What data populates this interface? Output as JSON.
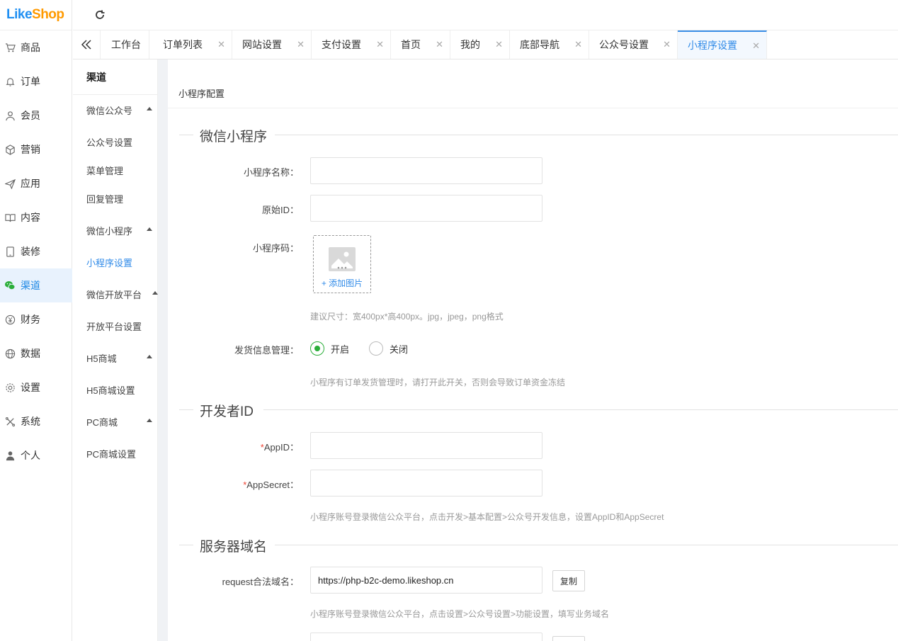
{
  "logo": {
    "part1": "Like",
    "part2": "Shop"
  },
  "sidebar": {
    "items": [
      {
        "label": "商品",
        "icon": "cart-icon"
      },
      {
        "label": "订单",
        "icon": "bell-icon"
      },
      {
        "label": "会员",
        "icon": "user-icon"
      },
      {
        "label": "营销",
        "icon": "cube-icon"
      },
      {
        "label": "应用",
        "icon": "send-icon"
      },
      {
        "label": "内容",
        "icon": "book-icon"
      },
      {
        "label": "装修",
        "icon": "tablet-icon"
      },
      {
        "label": "渠道",
        "icon": "wechat-icon"
      },
      {
        "label": "财务",
        "icon": "yen-icon"
      },
      {
        "label": "数据",
        "icon": "globe-icon"
      },
      {
        "label": "设置",
        "icon": "gear-icon"
      },
      {
        "label": "系统",
        "icon": "tools-icon"
      },
      {
        "label": "个人",
        "icon": "person-icon"
      }
    ],
    "active": "渠道"
  },
  "tabs": [
    {
      "label": "工作台",
      "closable": false
    },
    {
      "label": "订单列表",
      "closable": true
    },
    {
      "label": "网站设置",
      "closable": true
    },
    {
      "label": "支付设置",
      "closable": true
    },
    {
      "label": "首页",
      "closable": true
    },
    {
      "label": "我的",
      "closable": true
    },
    {
      "label": "底部导航",
      "closable": true
    },
    {
      "label": "公众号设置",
      "closable": true
    },
    {
      "label": "小程序设置",
      "closable": true,
      "active": true
    }
  ],
  "tab_close_glyph": "✕",
  "submenu": {
    "title": "渠道",
    "groups": [
      {
        "label": "微信公众号",
        "links": [
          "公众号设置",
          "菜单管理",
          "回复管理"
        ]
      },
      {
        "label": "微信小程序",
        "links": [
          "小程序设置"
        ]
      },
      {
        "label": "微信开放平台",
        "links": [
          "开放平台设置"
        ]
      },
      {
        "label": "H5商城",
        "links": [
          "H5商城设置"
        ]
      },
      {
        "label": "PC商城",
        "links": [
          "PC商城设置"
        ]
      }
    ],
    "active_link": "小程序设置"
  },
  "main": {
    "card_title": "小程序配置",
    "section_wechat": "微信小程序",
    "name_label": "小程序名称：",
    "name_value": "",
    "origin_label": "原始ID：",
    "origin_value": "",
    "qrcode_label": "小程序码：",
    "add_image": "+ 添加图片",
    "qrcode_hint": "建议尺寸：宽400px*高400px。jpg，jpeg，png格式",
    "ship_label": "发货信息管理：",
    "ship_on": "开启",
    "ship_off": "关闭",
    "ship_selected": "开启",
    "ship_hint": "小程序有订单发货管理时，请打开此开关，否则会导致订单资金冻结",
    "section_dev": "开发者ID",
    "appid_label": "AppID：",
    "appid_value": "",
    "appsecret_label": "AppSecret：",
    "appsecret_value": "",
    "required_mark": "*",
    "dev_hint": "小程序账号登录微信公众平台，点击开发>基本配置>公众号开发信息，设置AppID和AppSecret",
    "section_domain": "服务器域名",
    "request_label": "request合法域名：",
    "request_value": "https://php-b2c-demo.likeshop.cn",
    "copy_label": "复制",
    "domain_hint": "小程序账号登录微信公众平台，点击设置>公众号设置>功能设置，填写业务域名"
  },
  "colors": {
    "accent": "#2f8ae8",
    "green": "#2bae3a",
    "logo_blue": "#1f8ff2",
    "logo_orange": "#ff9a00"
  }
}
